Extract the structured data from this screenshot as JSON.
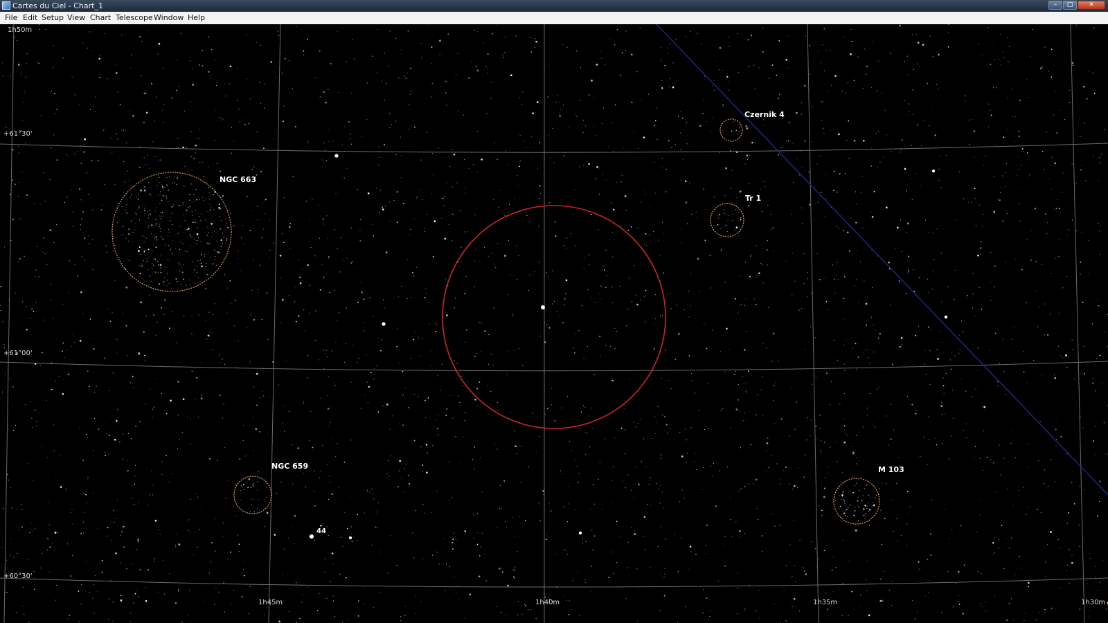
{
  "window": {
    "title": "Cartes du Ciel - Chart_1"
  },
  "menu": [
    "File",
    "Edit",
    "Setup",
    "View",
    "Chart",
    "Telescope",
    "Window",
    "Help"
  ],
  "coordinates": {
    "ra_top_left": "1h50m",
    "dec_labels": [
      "+61°30'",
      "+61°00'",
      "+60°30'"
    ],
    "ra_bottom": [
      "1h45m",
      "1h40m",
      "1h35m",
      "1h30m"
    ]
  },
  "objects": {
    "ngc663": "NGC 663",
    "czernik4": "Czernik 4",
    "tr1": "Tr 1",
    "ngc659": "NGC 659",
    "m103": "M 103",
    "star44": "44"
  },
  "colors": {
    "background": "#000000",
    "grid": "#6b6b6b",
    "cluster_circle": "#d7a14a",
    "fov_circle": "#c8242a",
    "ecliptic": "#1b2a8c"
  }
}
